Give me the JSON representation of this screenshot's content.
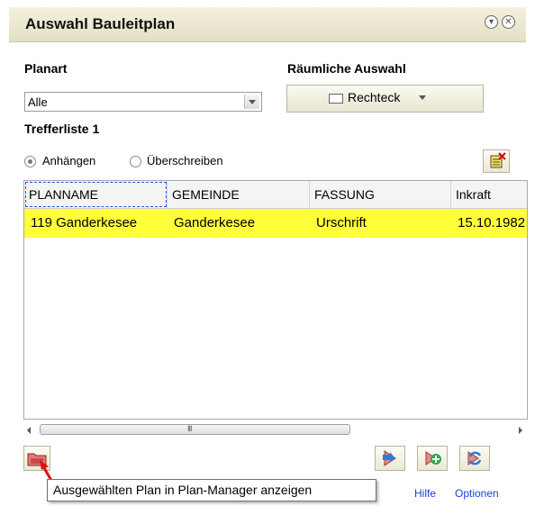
{
  "window": {
    "title": "Auswahl Bauleitplan",
    "collapse_icon": "collapse-circle-icon",
    "close_icon": "close-circle-icon"
  },
  "planart": {
    "label": "Planart",
    "selected": "Alle"
  },
  "spatial": {
    "label": "Räumliche Auswahl",
    "button_label": "Rechteck"
  },
  "results": {
    "label": "Trefferliste 1",
    "mode_append": "Anhängen",
    "mode_overwrite": "Überschreiben",
    "selected_mode": "Anhängen"
  },
  "table": {
    "columns": [
      "PLANNAME",
      "GEMEINDE",
      "FASSUNG",
      "Inkraft"
    ],
    "rows": [
      [
        "119 Ganderkesee",
        "Ganderkesee",
        "Urschrift",
        "15.10.1982"
      ]
    ],
    "highlight_color": "#ffff3a"
  },
  "scrollbar": {
    "grip": "III"
  },
  "tooltip": {
    "text": "Ausgewählten Plan in Plan-Manager anzeigen"
  },
  "footer": {
    "help_label": "Hilfe",
    "options_label": "Optionen"
  }
}
